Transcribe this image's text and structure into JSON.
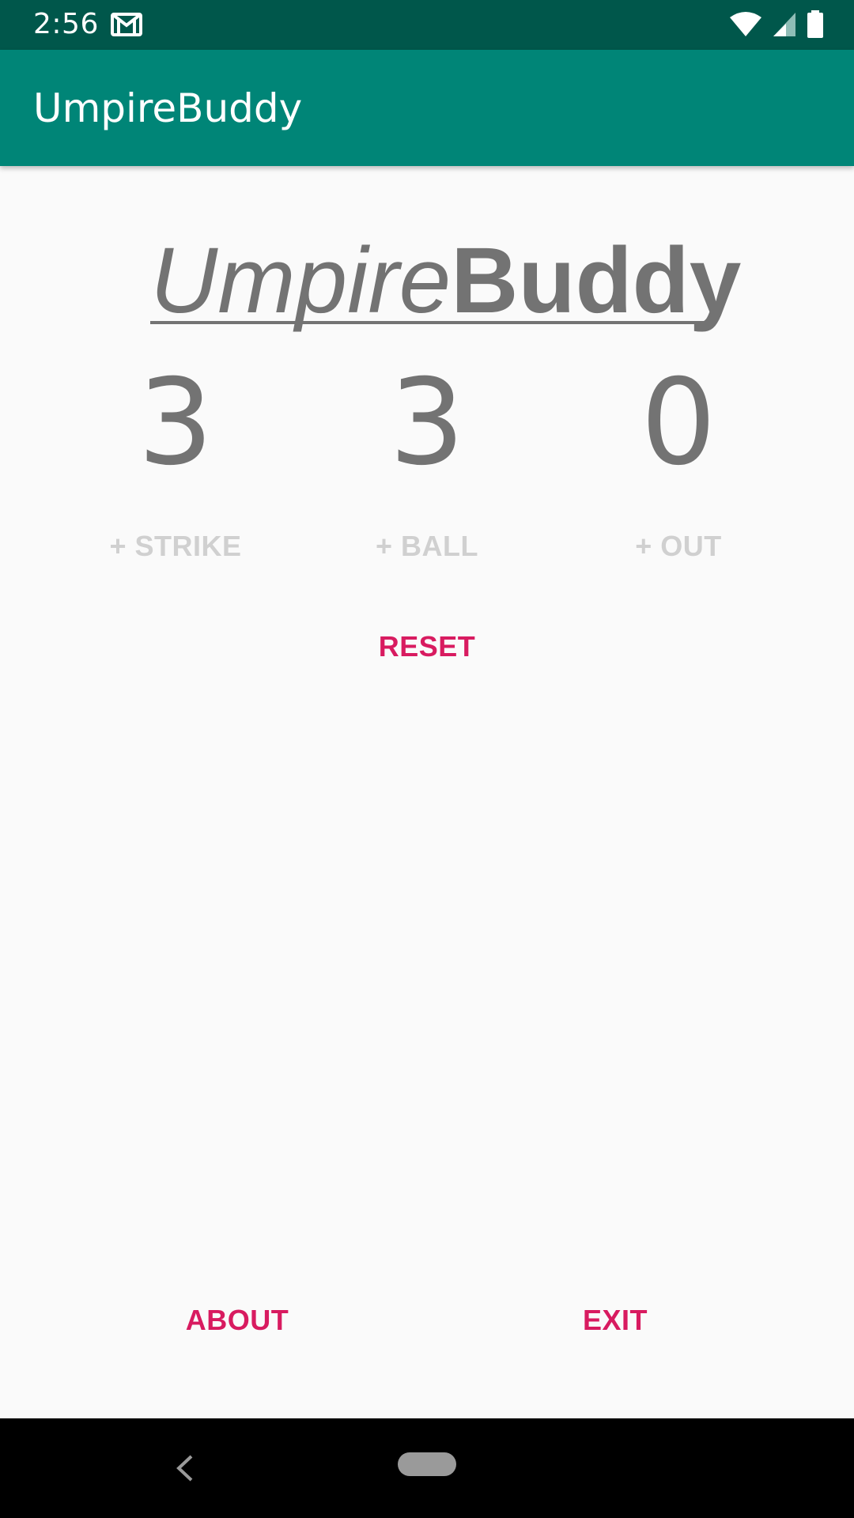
{
  "status_bar": {
    "time": "2:56",
    "icons": [
      "gmail-icon",
      "wifi-icon",
      "signal-icon",
      "battery-icon"
    ]
  },
  "app_bar": {
    "title": "UmpireBuddy",
    "color": "#008577"
  },
  "logo": {
    "part1": "Umpire",
    "part2": "Buddy"
  },
  "counters": {
    "strikes": "3",
    "balls": "3",
    "outs": "0"
  },
  "buttons": {
    "strike": "+ STRIKE",
    "ball": "+ BALL",
    "out": "+ OUT",
    "reset": "RESET",
    "about": "ABOUT",
    "exit": "EXIT"
  },
  "colors": {
    "accent": "#d81b60",
    "status_bar": "#00574b",
    "counter_text": "#737373",
    "disabled_text": "#d0d0d0"
  },
  "nav_bar": {
    "icons": [
      "back-icon",
      "home-pill-icon"
    ]
  }
}
